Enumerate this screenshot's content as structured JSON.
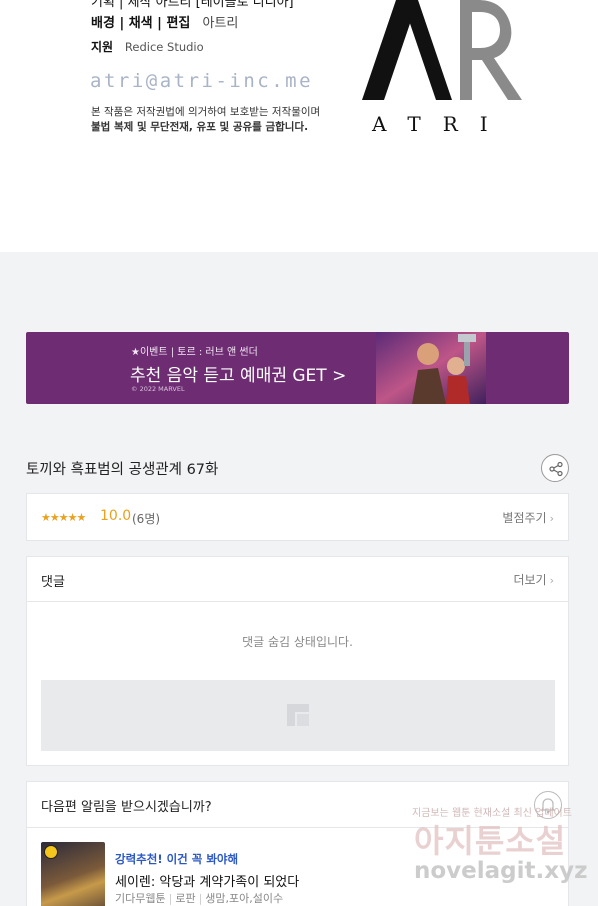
{
  "credits": {
    "cut_line": "기획 | 제작   아트리 [레이블로 디디아]",
    "bg": {
      "role": "배경 | 채색 | 편집",
      "name": "아트리"
    },
    "support": {
      "role": "지원",
      "name": "Redice Studio"
    },
    "email": "atri@atri-inc.me",
    "copyright_line1": "본 작품은 저작권법에 의거하여 보호받는 저작물이며",
    "copyright_line2": "불법 복제 및 무단전재, 유포 및 공유를 금합니다.",
    "logo_word": "ATRI"
  },
  "banner": {
    "small_text": "★이벤트 | 토르 : 러브 앤 썬더",
    "main_text": "추천 음악 듣고 예매권 GET >",
    "copy_text": "© 2022 MARVEL"
  },
  "episode": {
    "title": "토끼와 흑표범의 공생관계 67화"
  },
  "rating": {
    "stars": "★★★★★",
    "score": "10.0",
    "votes": "(6명)",
    "rate_link": "별점주기"
  },
  "comments": {
    "title": "댓글",
    "more_link": "더보기",
    "hidden_message": "댓글 숨김 상태입니다."
  },
  "next_alarm": {
    "title": "다음편 알림을 받으시겠습니까?",
    "rec_tag": "강력추천! 이건 꼭 봐야해",
    "rec_title": "세이렌: 악당과 계약가족이 되었다",
    "rec_meta": [
      "기다무웹툰",
      "로판",
      "생맘,포아,설이수"
    ]
  },
  "watermark": {
    "top": "지금보는 웹툰 현재소설 최신 업데이트",
    "big": "아지툰소설",
    "url": "novelagit.xyz"
  },
  "colors": {
    "banner_bg": "#6e2d73",
    "accent_star": "#e8a21f",
    "link_blue": "#2b58c4",
    "email": "#a9b4c7"
  }
}
